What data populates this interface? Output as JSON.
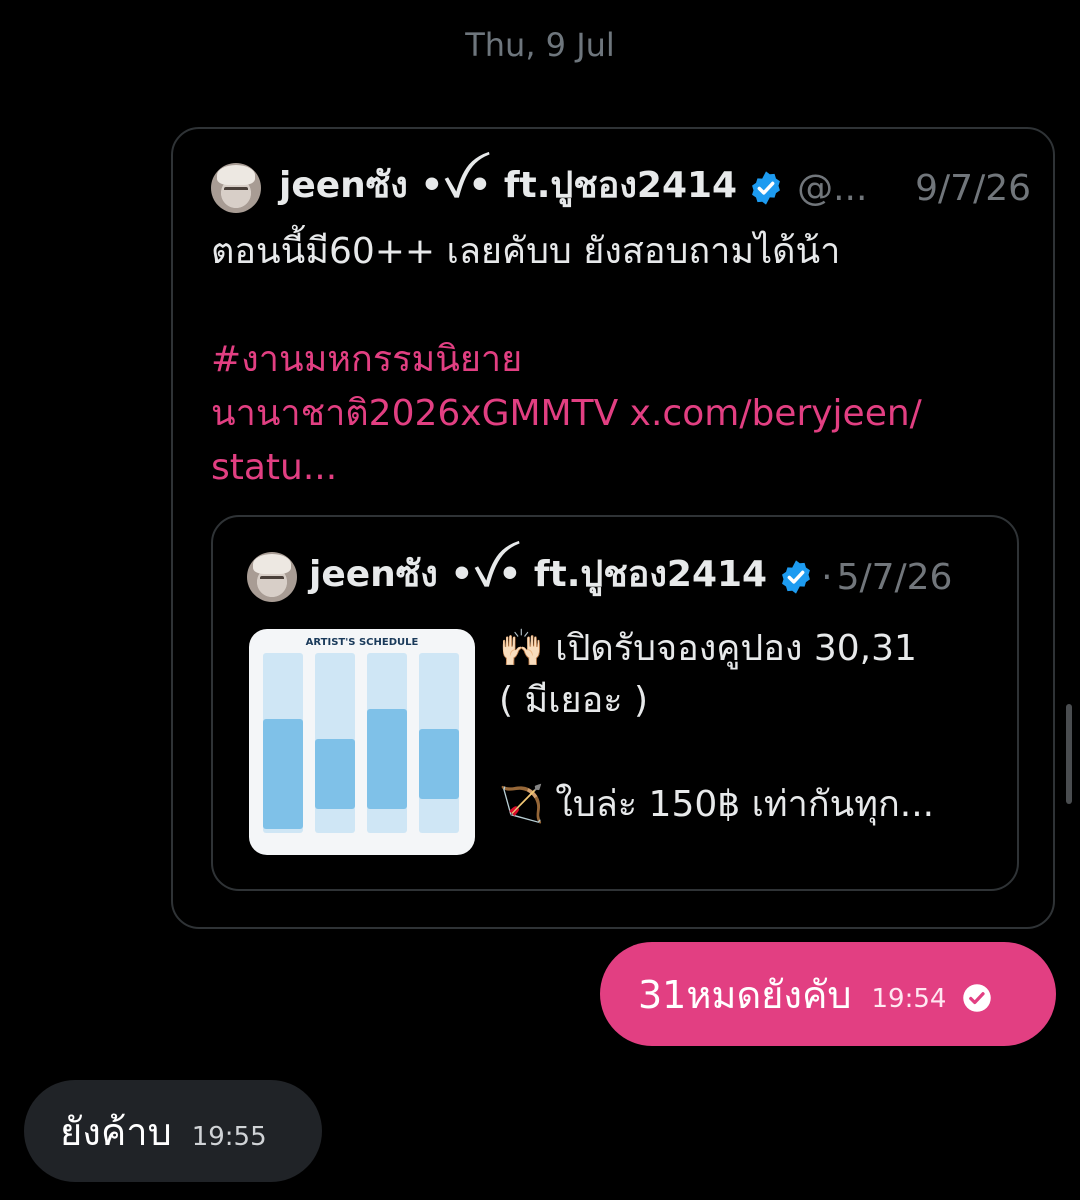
{
  "date_separator": "Thu, 9 Jul",
  "shared_post": {
    "display_name": "jeenซัง •ꪜ• ft.ปูชอง2414",
    "handle": "@...",
    "date": "9/7/26",
    "text_line1": "ตอนนี้มี60++ เลยคับบ ยังสอบถามได้น้า",
    "hashtag_line1": " #งานมหกรรมนิยาย",
    "hashtag_line2": "นานาชาติ2026xGMMTV",
    "link_line2": " x.com/beryjeen/",
    "link_line3": "statu...",
    "quoted_post": {
      "display_name": "jeenซัง •ꪜ• ft.ปูชอง2414",
      "dot": "·",
      "date": "5/7/26",
      "thumbnail_title": "ARTIST'S SCHEDULE",
      "text_line1": "🙌🏻 เปิดรับจองคูปอง 30,31",
      "text_line2": "( มีเยอะ )",
      "text_line3": "🏹 ใบล่ะ 150฿ เท่ากันทุก..."
    }
  },
  "sent_message": {
    "text": "31หมดยังคับ",
    "time": "19:54"
  },
  "received_message": {
    "text": "ยังค้าบ",
    "time": "19:55"
  },
  "colors": {
    "background": "#000000",
    "accent_pink": "#e23f82",
    "verified_blue": "#1d9bf0",
    "muted_text": "#71767b",
    "received_bubble": "#202327"
  },
  "icons": {
    "verified": "verified-badge-icon",
    "read_receipt": "read-check-icon"
  }
}
